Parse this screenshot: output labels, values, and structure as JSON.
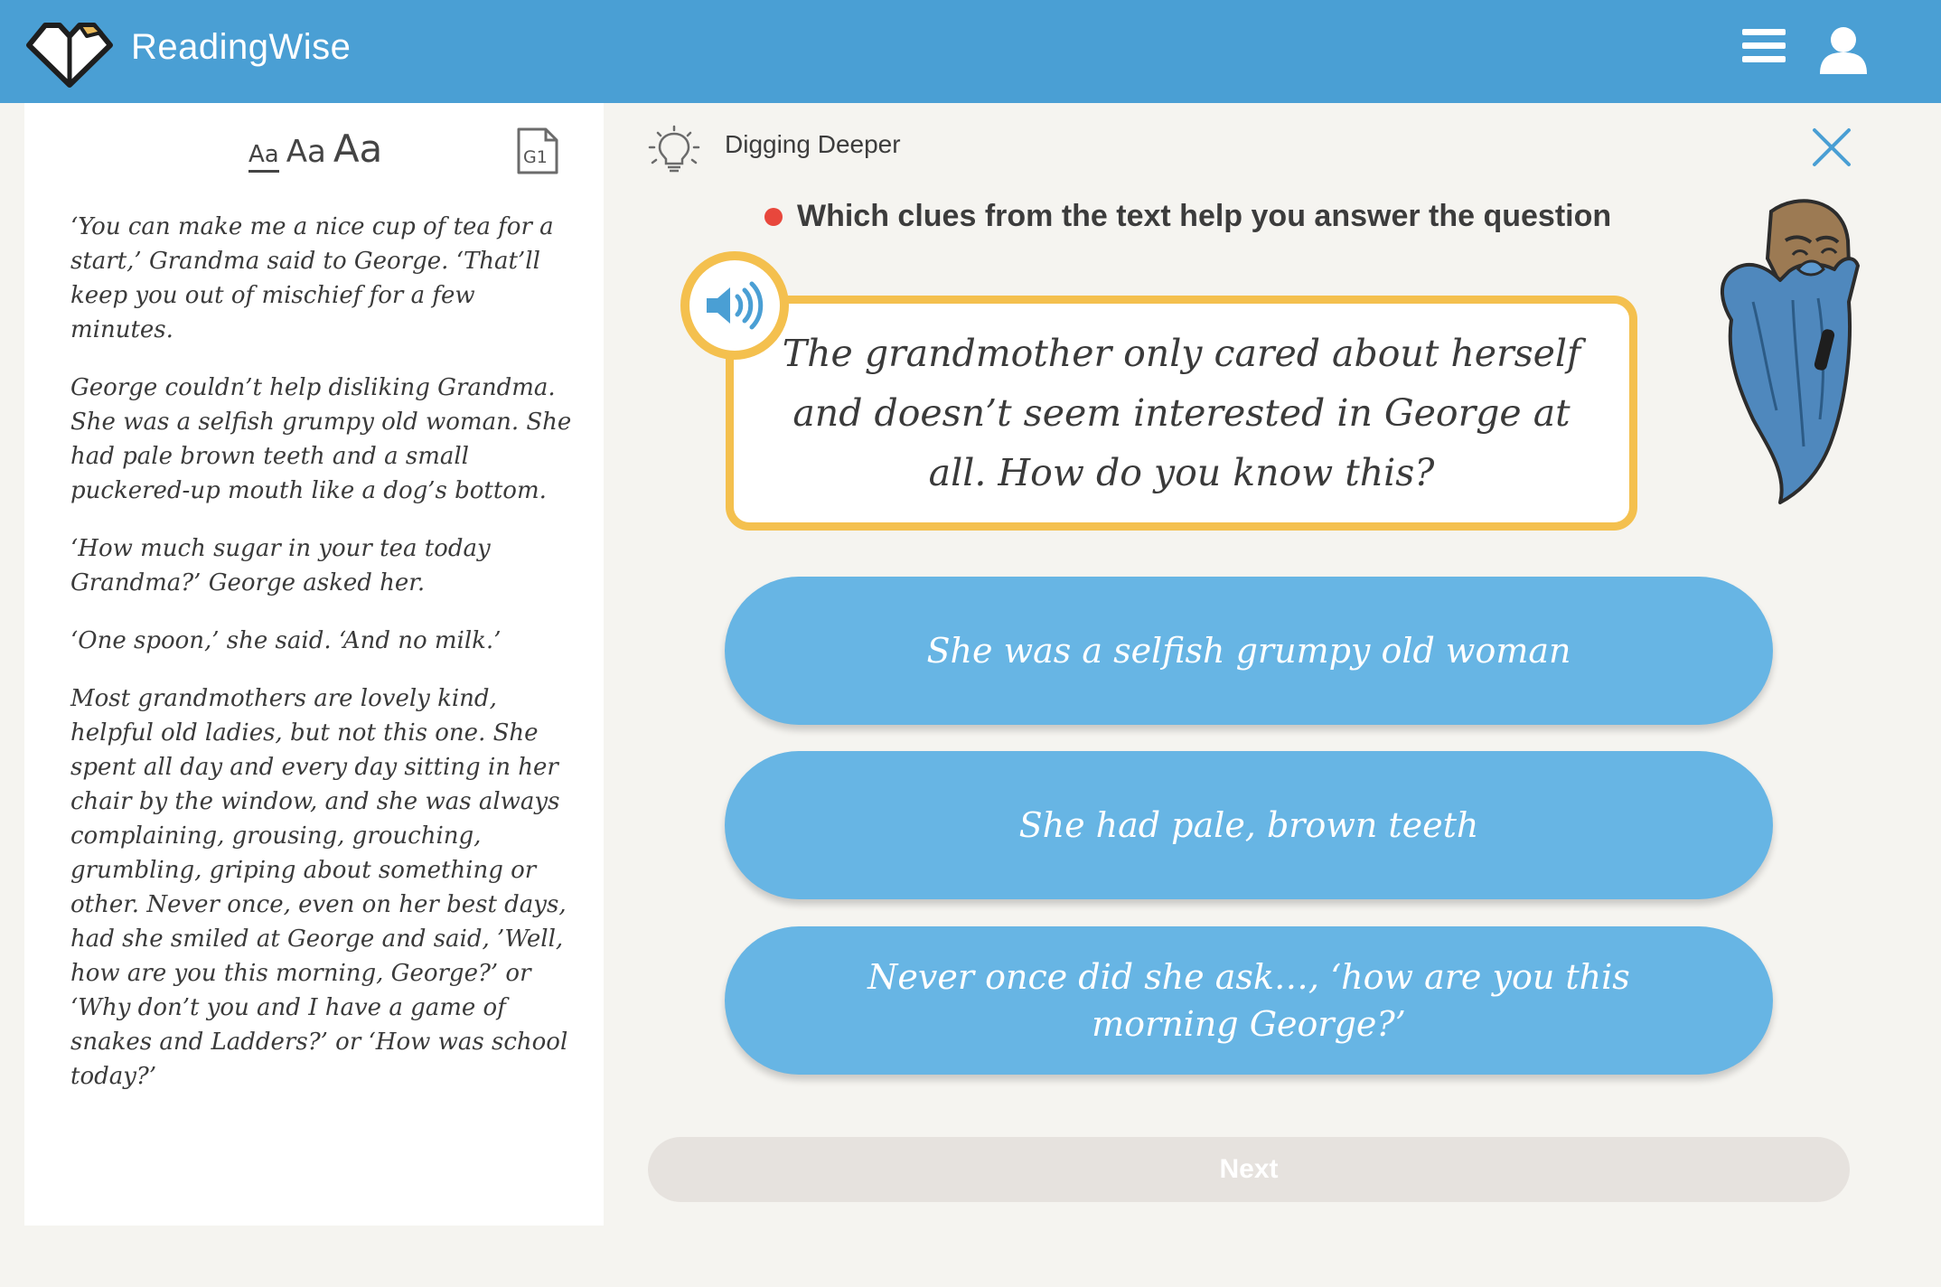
{
  "header": {
    "app_name": "ReadingWise",
    "background_color": "#4a9fd4",
    "icons": [
      "readingwise-logo-icon",
      "hamburger-menu-icon",
      "user-profile-icon"
    ]
  },
  "reader": {
    "font_size_options": [
      "Aa",
      "Aa",
      "Aa"
    ],
    "selected_font_size_index": 0,
    "grade_badge": "G1",
    "paragraphs": [
      "‘You can make me a nice cup of tea for a start,’ Grandma said to George. ‘That’ll keep you out of mischief for a few minutes.",
      "George couldn’t help disliking Grandma. She was a selfish grumpy old woman. She had pale brown teeth and a small puckered-up mouth like a dog’s bottom.",
      "‘How much sugar in your tea today Grandma?’ George asked her.",
      "‘One spoon,’ she said. ‘And no milk.’",
      "Most grandmothers are lovely kind, helpful old ladies, but not this one. She spent all day and every day sitting in her chair by the window, and she was always complaining, grousing, grouching, grumbling, griping about something or other. Never once, even on her best days, had she smiled at George and said, ’Well, how are you this morning, George?’ or ‘Why don’t you and I have a game of snakes and Ladders?’ or ‘How was school today?’"
    ]
  },
  "question": {
    "section_label": "Digging Deeper",
    "prompt": "Which clues from the text help you answer the question",
    "text": "The grandmother only cared about herself and doesn’t seem interested in George at all. How do you know this?",
    "accent_color": "#f4c04e",
    "prompt_dot_color": "#e8473c"
  },
  "answers": [
    "She was a selfish grumpy old woman",
    "She had pale, brown teeth",
    "Never once did she ask…, ‘how are you this morning George?’"
  ],
  "answer_color": "#67b5e4",
  "footer": {
    "next_label": "Next",
    "next_enabled": false
  }
}
